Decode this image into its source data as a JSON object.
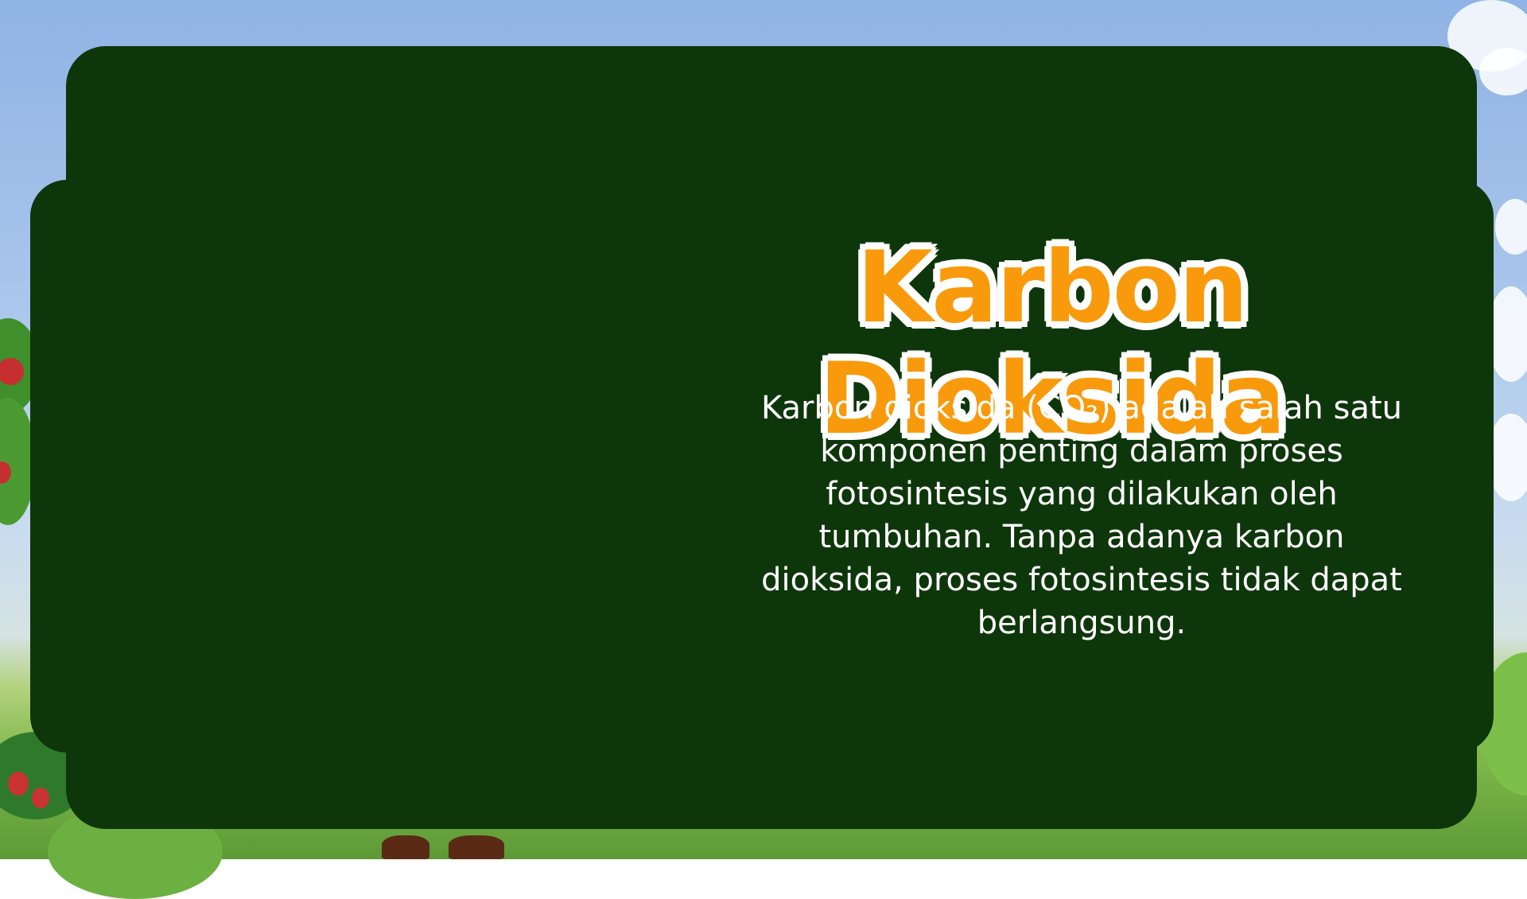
{
  "slide": {
    "title": "Karbon Dioksida",
    "body": "Karbon dioksida (CO₂) adalah salah satu komponen penting dalam proses fotosintesis yang dilakukan oleh tumbuhan. Tanpa adanya karbon dioksida, proses fotosintesis tidak dapat berlangsung."
  },
  "colors": {
    "panel": "#0e360b",
    "title_fill": "#f89a0c",
    "title_outline": "#ffffff",
    "body_text": "#ffffff"
  }
}
